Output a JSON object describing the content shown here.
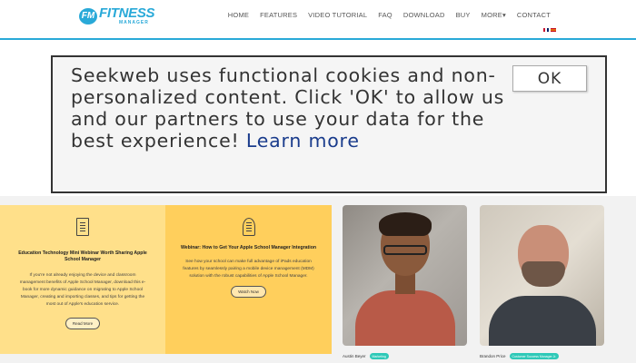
{
  "brand": {
    "logo_mark": "FM",
    "logo_title": "FITNESS",
    "logo_sub": "MANAGER",
    "accent": "#29a9d8"
  },
  "nav": {
    "items": [
      "HOME",
      "FEATURES",
      "VIDEO TUTORIAL",
      "FAQ",
      "DOWNLOAD",
      "BUY",
      "MORE▾",
      "CONTACT"
    ],
    "flags": [
      "flag-uk-icon",
      "flag-es-icon"
    ]
  },
  "cookie": {
    "message": "Seekweb uses functional cookies and non-personalized content. Click 'OK' to allow us and our partners to use your data for the best experience!",
    "learn_more": "Learn more",
    "ok_label": "OK"
  },
  "cards": [
    {
      "icon": "checklist-icon",
      "title": "Education Technology Mini Webinar Worth Sharing Apple School Manager",
      "body": "If you're not already enjoying the device and classroom management benefits of Apple School Manager, download this e-book for more dynamic guidance on migrating to Apple School Manager, creating and importing classes, and tips for getting the most out of Apple's education service.",
      "button": "Read More",
      "color": "#ffe08a"
    },
    {
      "icon": "webinar-icon",
      "title": "Webinar: How to Get Your Apple School Manager Integration",
      "body": "See how your school can make full advantage of iPads education features by seamlessly pairing a mobile device management (MDM) solution with the robust capabilities of Apple School Manager.",
      "button": "Watch Now",
      "color": "#ffcf5c"
    }
  ],
  "people": [
    {
      "name": "Austin Beyer",
      "tag": "Marketing",
      "icon": "person-photo-1"
    },
    {
      "name": "Brandon Price",
      "tag": "Customer Success Manager Jr.",
      "icon": "person-photo-2"
    }
  ]
}
